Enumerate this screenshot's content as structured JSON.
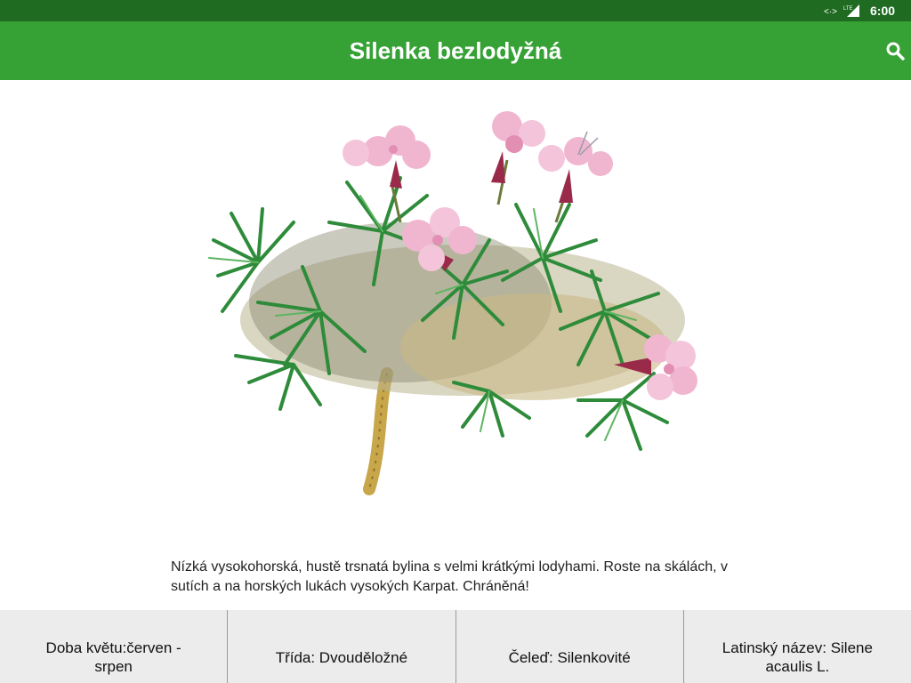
{
  "status_bar": {
    "network_label": "LTE",
    "time": "6:00",
    "icons": [
      "data-sync-icon",
      "signal-icon"
    ]
  },
  "app_bar": {
    "title": "Silenka bezlodyžná",
    "search_icon": "search-icon"
  },
  "main": {
    "illustration": "plant-illustration",
    "description": "Nízká vysokohorská, hustě trsnatá bylina s velmi krátkými lodyhami. Roste na skálách, v sutích a na horských lukách vysokých Karpat. Chráněná!"
  },
  "info_bar": [
    {
      "label": "Doba květu:červen - srpen"
    },
    {
      "label": "Třída: Dvouděložné"
    },
    {
      "label": "Čeleď: Silenkovité"
    },
    {
      "label": "Latinský název: Silene acaulis L."
    }
  ],
  "colors": {
    "status_bar": "#1f6b22",
    "app_bar": "#36a135",
    "info_bar_bg": "#ececec",
    "leaf": "#2e8b3a",
    "petal": "#f0b6d0",
    "calyx": "#9a2a4a",
    "root": "#c8a64a"
  }
}
